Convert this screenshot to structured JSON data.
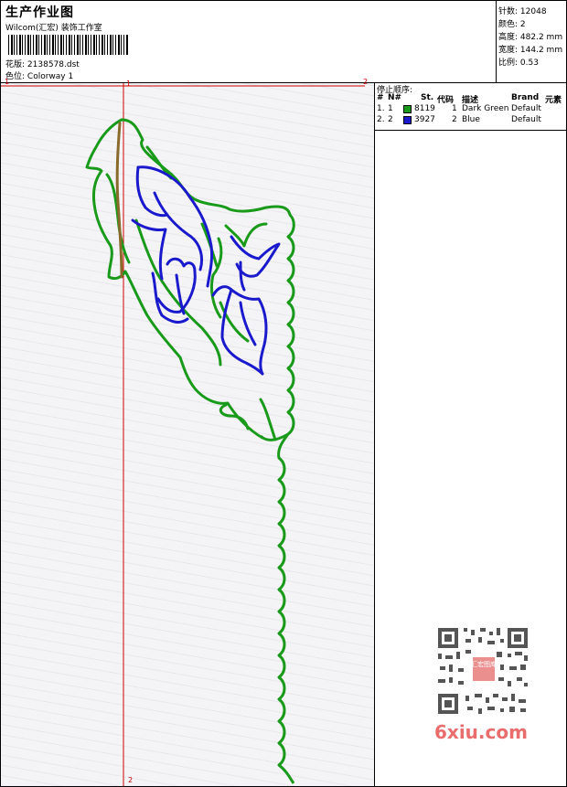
{
  "header": {
    "title": "生产作业图",
    "subtitle": "Wilcom(汇宏) 装饰工作室",
    "design_label": "花版:",
    "design_value": "2138578.dst",
    "colorway_label": "色位:",
    "colorway_value": "Colorway 1"
  },
  "stats": [
    {
      "label": "针数:",
      "value": "12048"
    },
    {
      "label": "颜色:",
      "value": "2"
    },
    {
      "label": "高度:",
      "value": "482.2 mm"
    },
    {
      "label": "宽度:",
      "value": "144.2 mm"
    },
    {
      "label": "比例:",
      "value": "0.53"
    }
  ],
  "stop_sequence": {
    "title": "停止顺序:",
    "columns": [
      "#",
      "N#",
      "St.",
      "代码",
      "描述",
      "Brand",
      "元素"
    ],
    "rows": [
      {
        "num": "1.",
        "n": "1",
        "stitches": "8119",
        "code": "1",
        "description": "Dark Green",
        "brand": "Default",
        "color": "#1a9a1a"
      },
      {
        "num": "2.",
        "n": "2",
        "stitches": "3927",
        "code": "2",
        "description": "Blue",
        "brand": "Default",
        "color": "#1a1acc"
      }
    ]
  },
  "markers": {
    "top_left": "1",
    "guide_top": "1",
    "top_right": "2",
    "bottom": "2"
  },
  "colors": {
    "thread_green": "#1a9a1a",
    "thread_blue": "#1a1acc",
    "thread_brown": "#8a6a2a",
    "guide_red": "#d00000",
    "brand_red": "#ea6d6d"
  },
  "watermark": {
    "qr_stamp": "汇宏图库",
    "brand": "6xiu.com"
  }
}
